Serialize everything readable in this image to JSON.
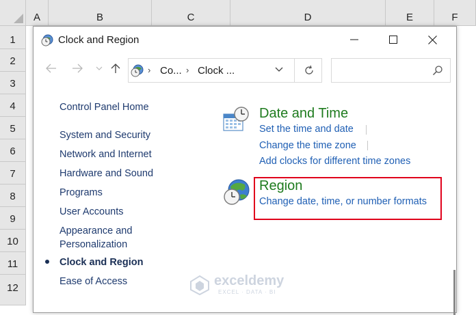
{
  "excel": {
    "columns": [
      "A",
      "B",
      "C",
      "D",
      "E",
      "F"
    ],
    "rows": [
      "1",
      "2",
      "3",
      "4",
      "5",
      "6",
      "7",
      "8",
      "9",
      "10",
      "11",
      "12"
    ]
  },
  "window": {
    "title": "Clock and Region",
    "minimize_icon": "minimize-icon",
    "maximize_icon": "maximize-icon",
    "close_icon": "close-icon"
  },
  "navbar": {
    "back_icon": "back-arrow-icon",
    "forward_icon": "forward-arrow-icon",
    "recent_icon": "chevron-down-icon",
    "up_icon": "up-arrow-icon",
    "address": {
      "crumbs": [
        "Co...",
        "Clock ..."
      ],
      "separator": "›",
      "dropdown_icon": "chevron-down-icon",
      "refresh_icon": "refresh-icon"
    },
    "search": {
      "placeholder": "",
      "value": "",
      "icon": "search-icon"
    }
  },
  "sidebar": {
    "home": "Control Panel Home",
    "items": [
      {
        "label": "System and Security"
      },
      {
        "label": "Network and Internet"
      },
      {
        "label": "Hardware and Sound"
      },
      {
        "label": "Programs"
      },
      {
        "label": "User Accounts"
      },
      {
        "label": "Appearance and"
      },
      {
        "label": "Personalization"
      },
      {
        "label": "Clock and Region"
      },
      {
        "label": "Ease of Access"
      }
    ],
    "current": "Clock and Region"
  },
  "categories": {
    "date_time": {
      "title": "Date and Time",
      "icon": "date-time-icon",
      "tasks": [
        "Set the time and date",
        "Change the time zone",
        "Add clocks for different time zones"
      ]
    },
    "region": {
      "title": "Region",
      "icon": "globe-clock-icon",
      "tasks": [
        "Change date, time, or number formats"
      ],
      "highlight_color": "#e0001b"
    }
  },
  "watermark": {
    "name": "exceldemy",
    "tagline": "EXCEL · DATA · BI"
  },
  "colors": {
    "category_title": "#1e7b1e",
    "task_link": "#1f5fb4",
    "nav_link": "#1e3a6e"
  }
}
